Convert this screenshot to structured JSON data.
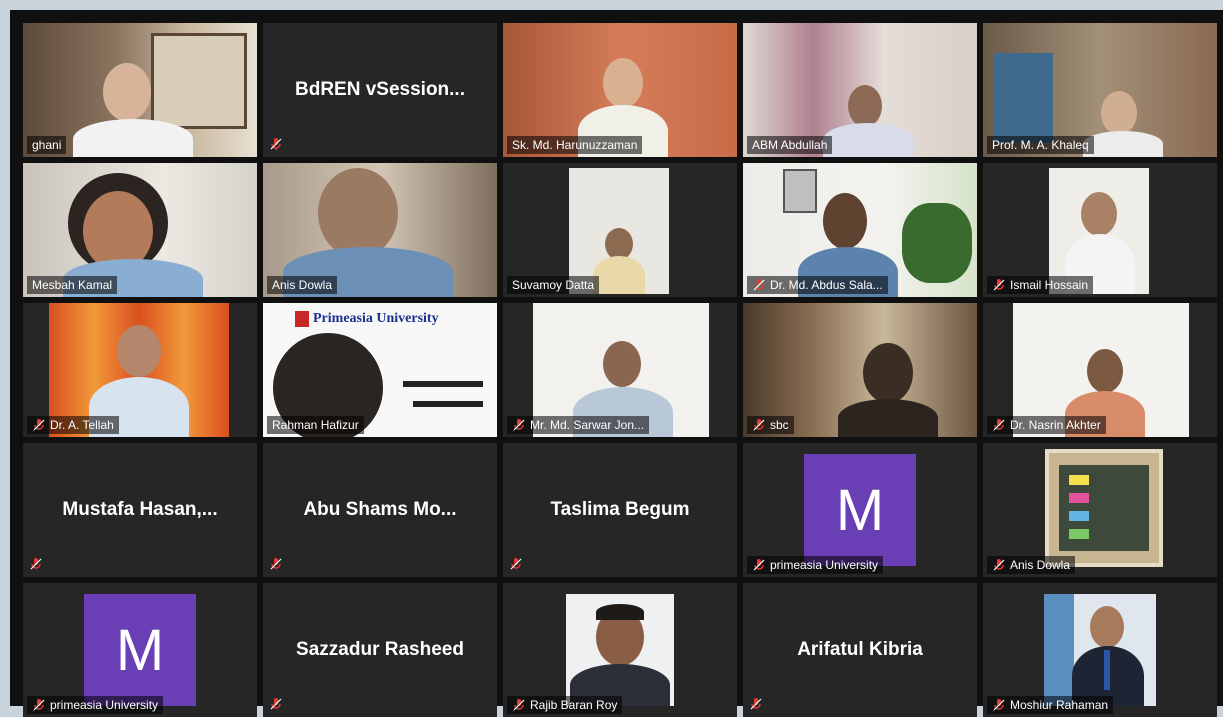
{
  "meeting": {
    "tiles": [
      {
        "name": "ghani"
      },
      {
        "center_name": "BdREN vSession..."
      },
      {
        "name": "Sk. Md. Harunuzzaman"
      },
      {
        "name": "ABM Abdullah"
      },
      {
        "name": "Prof. M. A. Khaleq"
      },
      {
        "name": "Mesbah Kamal"
      },
      {
        "name": "Anis Dowla"
      },
      {
        "name": "Suvamoy Datta"
      },
      {
        "name": "Dr. Md. Abdus Sala..."
      },
      {
        "name": "Ismail Hossain"
      },
      {
        "name": "Dr. A. Tellah"
      },
      {
        "name": "Rahman Hafizur",
        "logo": "Primeasia University"
      },
      {
        "name": "Mr. Md. Sarwar Jon..."
      },
      {
        "name": "sbc"
      },
      {
        "name": "Dr. Nasrin Akhter"
      },
      {
        "center_name": "Mustafa Hasan,..."
      },
      {
        "center_name": "Abu Shams Mo..."
      },
      {
        "center_name": "Taslima Begum"
      },
      {
        "name": "primeasia University",
        "avatar_letter": "M"
      },
      {
        "name": "Anis Dowla"
      },
      {
        "name": "primeasia University",
        "avatar_letter": "M"
      },
      {
        "center_name": "Sazzadur Rasheed"
      },
      {
        "name": "Rajib Baran Roy"
      },
      {
        "center_name": "Arifatul Kibria"
      },
      {
        "name": "Moshiur Rahaman"
      }
    ]
  },
  "icons": {
    "muted": "microphone-muted-icon"
  },
  "colors": {
    "active_speaker_border": "#e7d14a",
    "avatar_purple": "#6a3fb5",
    "muted_icon": "#e53935"
  }
}
